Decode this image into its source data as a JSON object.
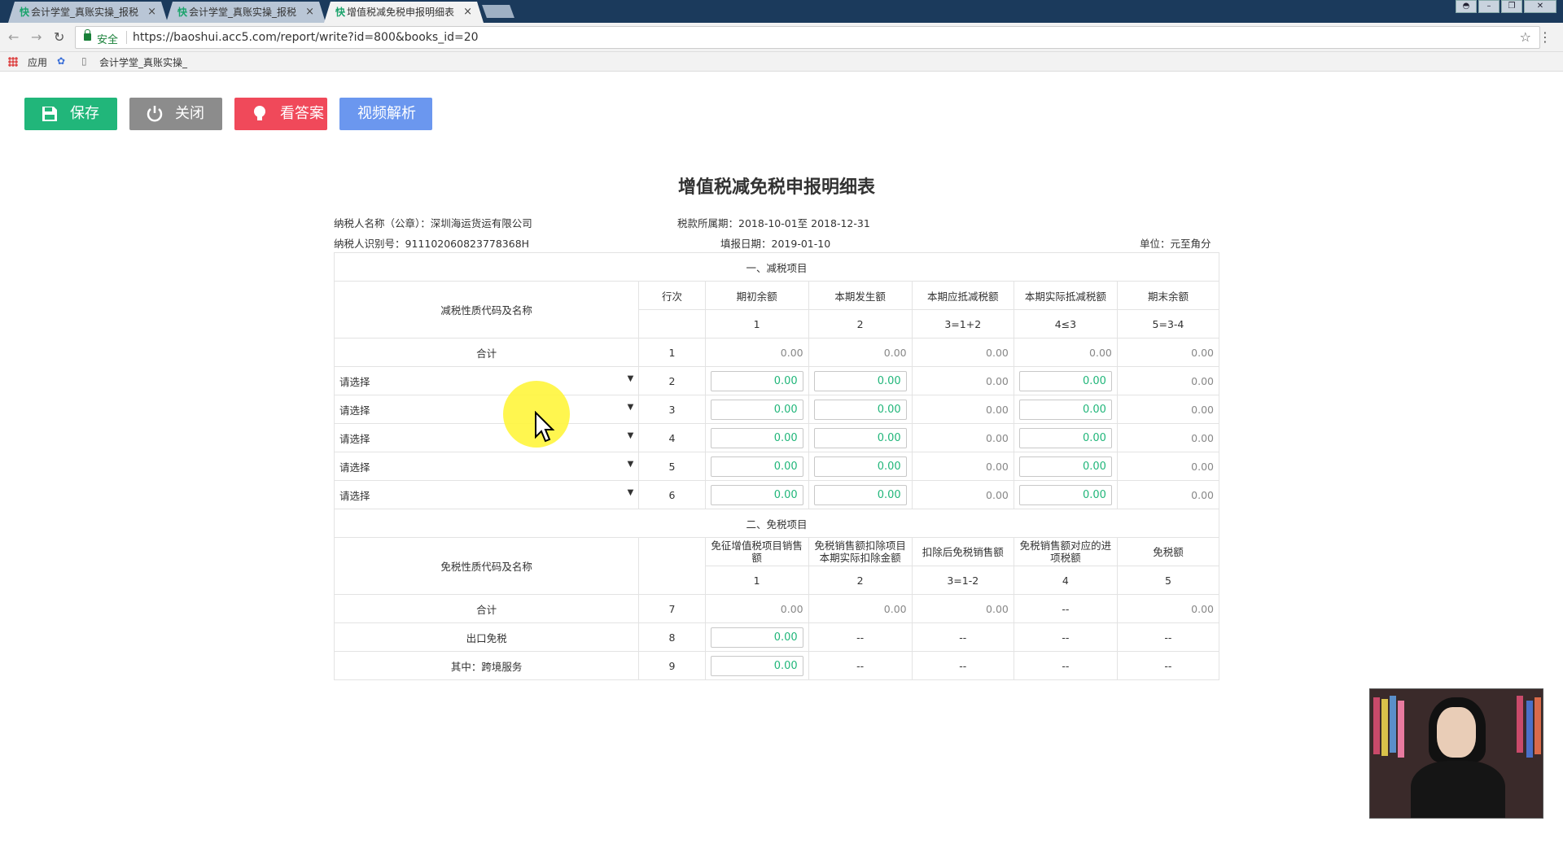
{
  "browser": {
    "tabs": [
      {
        "label": "会计学堂_真账实操_报税",
        "active": false
      },
      {
        "label": "会计学堂_真账实操_报税",
        "active": false
      },
      {
        "label": "增值税减免税申报明细表",
        "active": true
      }
    ],
    "secure_label": "安全",
    "url": "https://baoshui.acc5.com/report/write?id=800&books_id=20",
    "bookmarks": [
      "应用",
      "会计学堂_真账实操_"
    ]
  },
  "actions": {
    "save": "保存",
    "close": "关闭",
    "answer": "看答案",
    "video": "视频解析"
  },
  "report": {
    "title": "增值税减免税申报明细表",
    "taxpayer_name_label": "纳税人名称（公章）：",
    "taxpayer_name": "深圳海运货运有限公司",
    "tax_period_label": "税款所属期：",
    "tax_period": "2018-10-01至 2018-12-31",
    "taxpayer_id_label": "纳税人识别号：",
    "taxpayer_id": "911102060823778368H",
    "fill_date_label": "填报日期：",
    "fill_date": "2019-01-10",
    "unit": "单位：元至角分",
    "section1": {
      "title": "一、减税项目",
      "name_header": "减税性质代码及名称",
      "row_header": "行次",
      "col_headers": [
        "期初余额",
        "本期发生额",
        "本期应抵减税额",
        "本期实际抵减税额",
        "期末余额"
      ],
      "col_formulas": [
        "1",
        "2",
        "3=1+2",
        "4≤3",
        "5=3-4"
      ],
      "total_label": "合计",
      "total_row": {
        "no": "1",
        "values": [
          "0.00",
          "0.00",
          "0.00",
          "0.00",
          "0.00"
        ]
      },
      "select_placeholder": "请选择",
      "rows": [
        {
          "no": "2",
          "values": [
            "0.00",
            "0.00",
            "0.00",
            "0.00",
            "0.00"
          ]
        },
        {
          "no": "3",
          "values": [
            "0.00",
            "0.00",
            "0.00",
            "0.00",
            "0.00"
          ]
        },
        {
          "no": "4",
          "values": [
            "0.00",
            "0.00",
            "0.00",
            "0.00",
            "0.00"
          ]
        },
        {
          "no": "5",
          "values": [
            "0.00",
            "0.00",
            "0.00",
            "0.00",
            "0.00"
          ]
        },
        {
          "no": "6",
          "values": [
            "0.00",
            "0.00",
            "0.00",
            "0.00",
            "0.00"
          ]
        }
      ]
    },
    "section2": {
      "title": "二、免税项目",
      "name_header": "免税性质代码及名称",
      "col_headers": [
        "免征增值税项目销售额",
        "免税销售额扣除项目本期实际扣除金额",
        "扣除后免税销售额",
        "免税销售额对应的进项税额",
        "免税额"
      ],
      "col_formulas": [
        "1",
        "2",
        "3=1-2",
        "4",
        "5"
      ],
      "total_label": "合计",
      "total_row": {
        "no": "7",
        "values": [
          "0.00",
          "0.00",
          "0.00",
          "--",
          "0.00"
        ]
      },
      "rows": [
        {
          "label": "出口免税",
          "no": "8",
          "value": "0.00",
          "rest": [
            "--",
            "--",
            "--",
            "--"
          ]
        },
        {
          "label": "其中：跨境服务",
          "no": "9",
          "value": "0.00",
          "rest": [
            "--",
            "--",
            "--",
            "--"
          ]
        }
      ]
    }
  }
}
